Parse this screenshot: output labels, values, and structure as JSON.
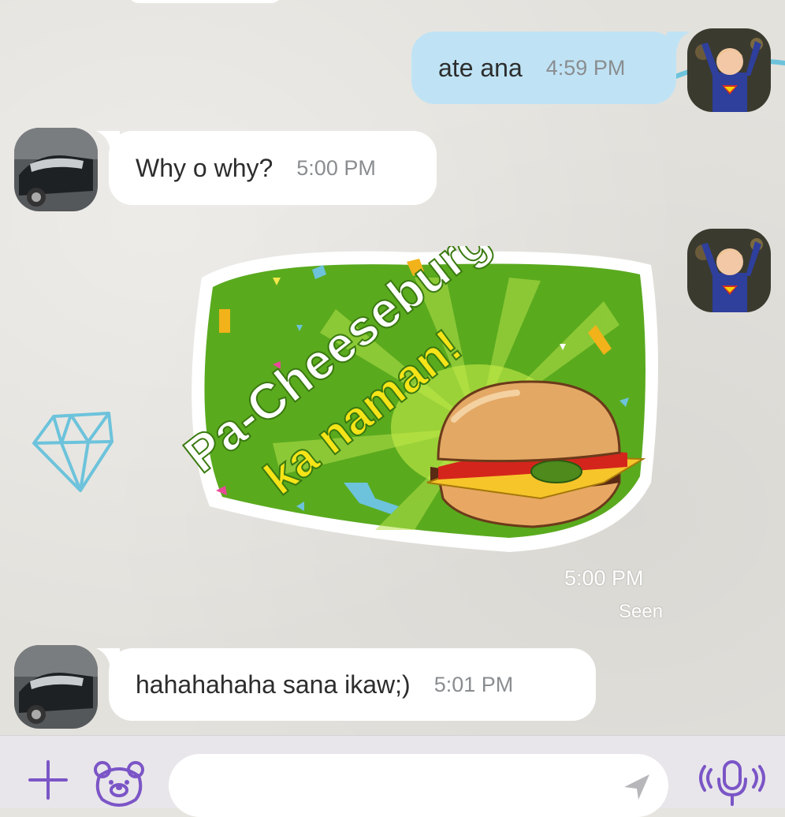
{
  "messages": [
    {
      "id": "m1",
      "direction": "outgoing",
      "text": "ate ana",
      "time": "4:59 PM"
    },
    {
      "id": "m2",
      "direction": "incoming",
      "text": "Why o why?",
      "time": "5:00 PM"
    },
    {
      "id": "m3",
      "direction": "outgoing",
      "type": "sticker",
      "sticker_text_line1": "Pa-Cheeseburger",
      "sticker_text_line2": "ka naman!",
      "time": "5:00 PM",
      "status": "Seen"
    },
    {
      "id": "m4",
      "direction": "incoming",
      "text": "hahahahaha sana ikaw;)",
      "time": "5:01 PM"
    }
  ],
  "composer": {
    "placeholder": "",
    "value": "",
    "icons": [
      "plus-icon",
      "sticker-bear-icon",
      "send-arrow-icon",
      "voice-mic-icon"
    ]
  },
  "colors": {
    "outgoing_bubble": "#bfe3f5",
    "incoming_bubble": "#ffffff",
    "accent_purple": "#7b55c7",
    "sticker_green": "#5aaa1e"
  }
}
